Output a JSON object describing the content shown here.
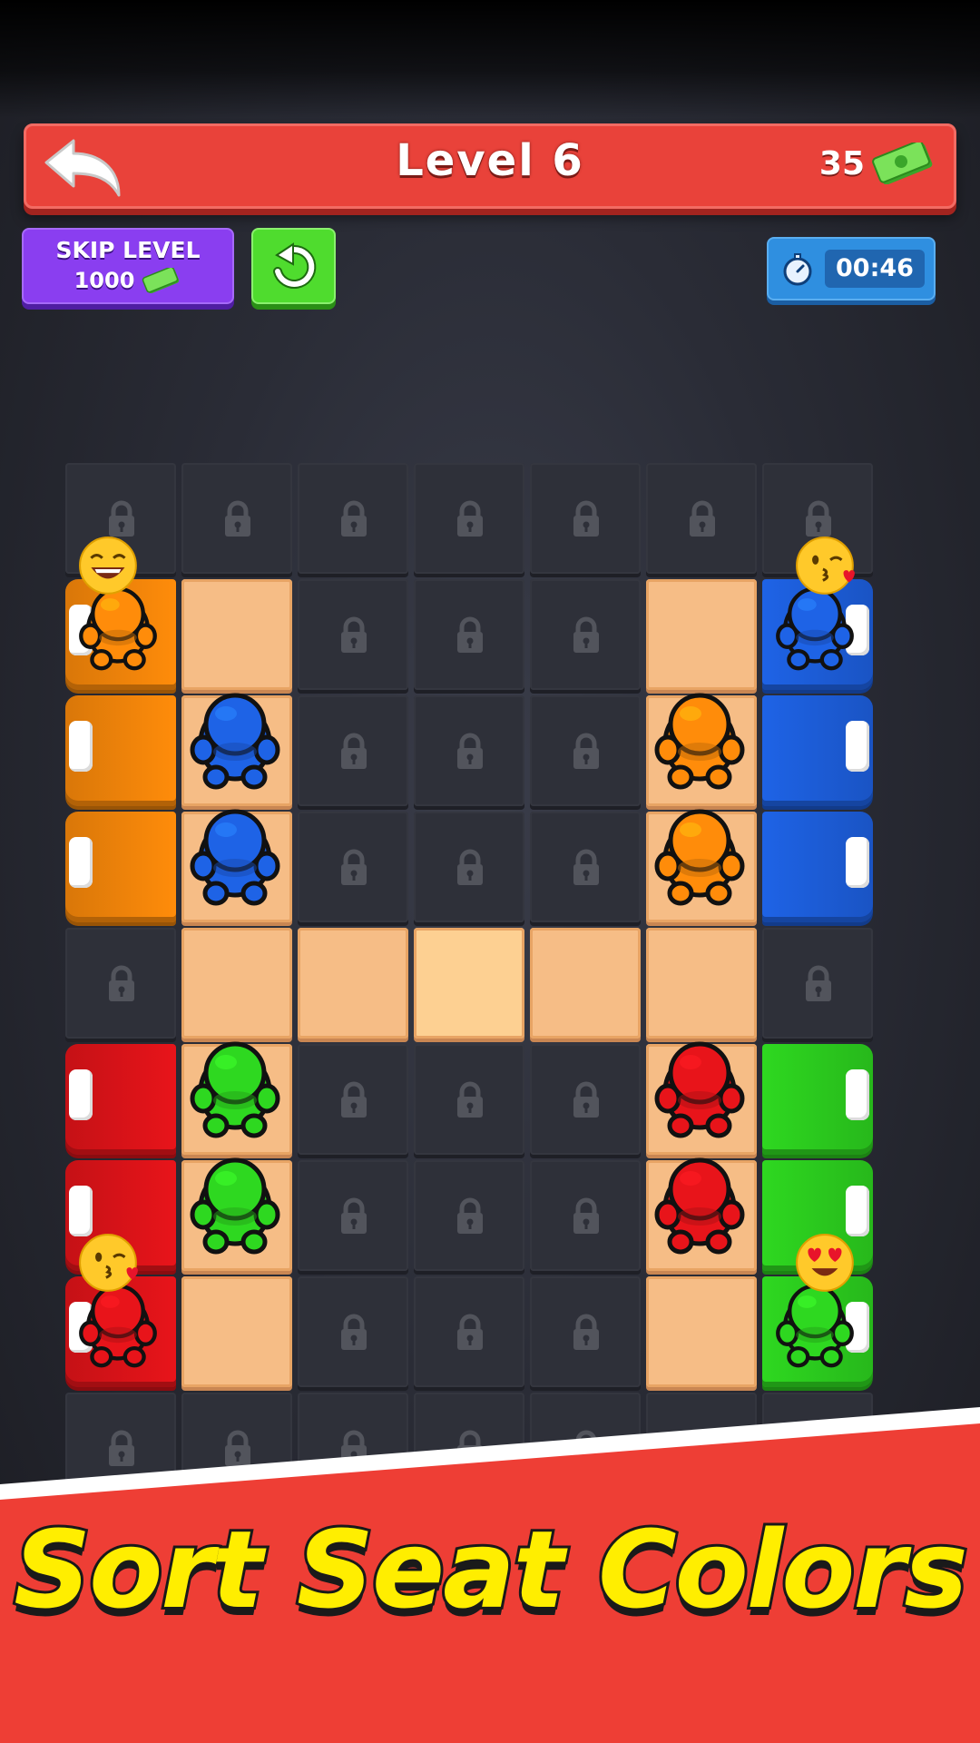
{
  "header": {
    "level_title": "Level 6",
    "money": "35"
  },
  "skip": {
    "label": "SKIP LEVEL",
    "cost": "1000"
  },
  "timer": {
    "value": "00:46"
  },
  "banner": {
    "text": "Sort Seat Colors"
  },
  "colors": {
    "orange": "#ff8c0a",
    "blue": "#1e63e6",
    "red": "#e8141a",
    "green": "#2ed820",
    "tile": "#f6bd86",
    "locked": "#2e3039",
    "header": "#e9423a",
    "banner": "#ee3e35"
  },
  "icons": [
    "back-arrow-icon",
    "cash-icon",
    "refresh-icon",
    "stopwatch-icon",
    "lock-icon"
  ]
}
